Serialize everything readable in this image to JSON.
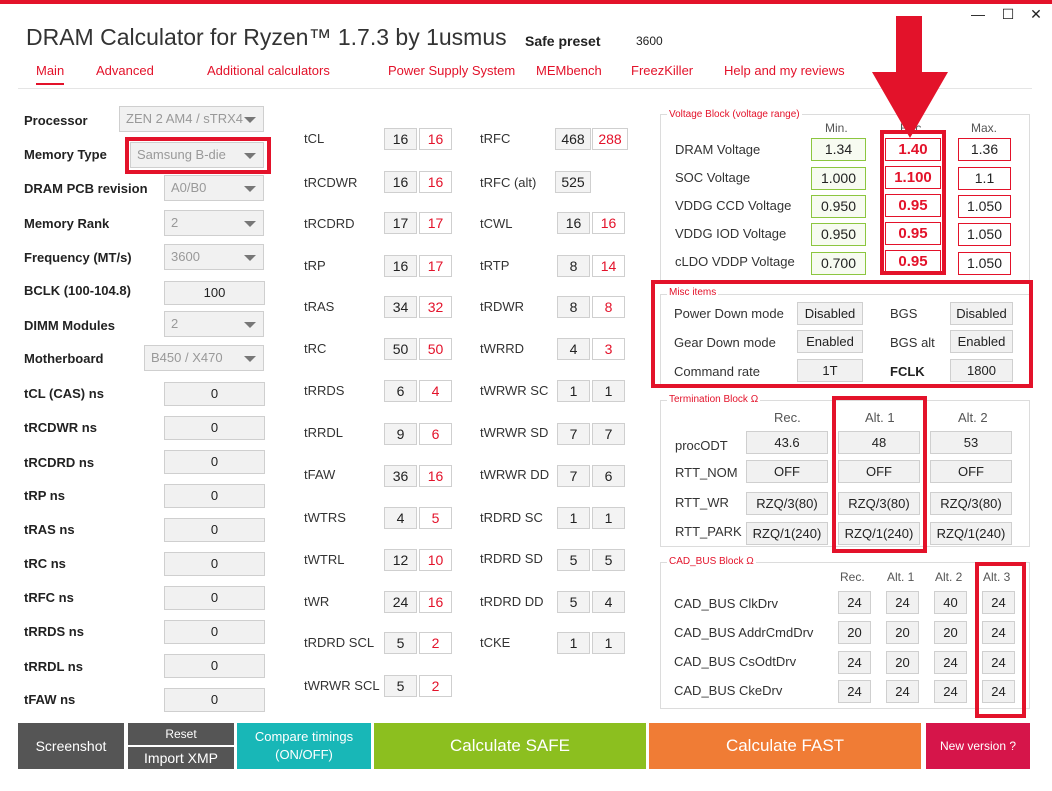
{
  "app": {
    "title": "DRAM Calculator for Ryzen™ 1.7.3 by 1usmus",
    "preset_label": "Safe preset",
    "preset_value": "3600",
    "window_controls": [
      "—",
      "☐",
      "✕"
    ]
  },
  "tabs": [
    "Main",
    "Advanced",
    "Additional calculators",
    "Power Supply System",
    "MEMbench",
    "FreezKiller",
    "Help and my reviews"
  ],
  "left": {
    "fields": [
      {
        "label": "Processor",
        "value": "ZEN 2 AM4 / sTRX4",
        "type": "select"
      },
      {
        "label": "Memory Type",
        "value": "Samsung B-die",
        "type": "select"
      },
      {
        "label": "DRAM PCB revision",
        "value": "A0/B0",
        "type": "select"
      },
      {
        "label": "Memory Rank",
        "value": "2",
        "type": "select"
      },
      {
        "label": "Frequency (MT/s)",
        "value": "3600",
        "type": "select"
      },
      {
        "label": "BCLK (100-104.8)",
        "value": "100",
        "type": "input"
      },
      {
        "label": "DIMM Modules",
        "value": "2",
        "type": "select"
      },
      {
        "label": "Motherboard",
        "value": "B450 / X470",
        "type": "select"
      }
    ],
    "ns_fields": [
      {
        "label": "tCL (CAS) ns",
        "value": "0"
      },
      {
        "label": "tRCDWR ns",
        "value": "0"
      },
      {
        "label": "tRCDRD ns",
        "value": "0"
      },
      {
        "label": "tRP ns",
        "value": "0"
      },
      {
        "label": "tRAS ns",
        "value": "0"
      },
      {
        "label": "tRC ns",
        "value": "0"
      },
      {
        "label": "tRFC ns",
        "value": "0"
      },
      {
        "label": "tRRDS ns",
        "value": "0"
      },
      {
        "label": "tRRDL ns",
        "value": "0"
      },
      {
        "label": "tFAW ns",
        "value": "0"
      }
    ]
  },
  "timings_col1": [
    {
      "label": "tCL",
      "v1": "16",
      "v2": "16"
    },
    {
      "label": "tRCDWR",
      "v1": "16",
      "v2": "16"
    },
    {
      "label": "tRCDRD",
      "v1": "17",
      "v2": "17"
    },
    {
      "label": "tRP",
      "v1": "16",
      "v2": "17"
    },
    {
      "label": "tRAS",
      "v1": "34",
      "v2": "32"
    },
    {
      "label": "tRC",
      "v1": "50",
      "v2": "50"
    },
    {
      "label": "tRRDS",
      "v1": "6",
      "v2": "4"
    },
    {
      "label": "tRRDL",
      "v1": "9",
      "v2": "6"
    },
    {
      "label": "tFAW",
      "v1": "36",
      "v2": "16"
    },
    {
      "label": "tWTRS",
      "v1": "4",
      "v2": "5"
    },
    {
      "label": "tWTRL",
      "v1": "12",
      "v2": "10"
    },
    {
      "label": "tWR",
      "v1": "24",
      "v2": "16"
    },
    {
      "label": "tRDRD SCL",
      "v1": "5",
      "v2": "2"
    },
    {
      "label": "tWRWR SCL",
      "v1": "5",
      "v2": "2"
    }
  ],
  "timings_col2": [
    {
      "label": "tRFC",
      "v1": "468",
      "v2": "288"
    },
    {
      "label": "tRFC (alt)",
      "v1": "525",
      "v2": ""
    },
    {
      "label": "tCWL",
      "v1": "16",
      "v2": "16"
    },
    {
      "label": "tRTP",
      "v1": "8",
      "v2": "14"
    },
    {
      "label": "tRDWR",
      "v1": "8",
      "v2": "8"
    },
    {
      "label": "tWRRD",
      "v1": "4",
      "v2": "3"
    },
    {
      "label": "tWRWR SC",
      "v1": "1",
      "v2": "1"
    },
    {
      "label": "tWRWR SD",
      "v1": "7",
      "v2": "7"
    },
    {
      "label": "tWRWR DD",
      "v1": "7",
      "v2": "6"
    },
    {
      "label": "tRDRD SC",
      "v1": "1",
      "v2": "1"
    },
    {
      "label": "tRDRD SD",
      "v1": "5",
      "v2": "5"
    },
    {
      "label": "tRDRD DD",
      "v1": "5",
      "v2": "4"
    },
    {
      "label": "tCKE",
      "v1": "1",
      "v2": "1"
    }
  ],
  "voltage": {
    "title": "Voltage Block (voltage range)",
    "headers": [
      "Min.",
      "Rec.",
      "Max."
    ],
    "rows": [
      {
        "label": "DRAM Voltage",
        "min": "1.34",
        "rec": "1.40",
        "max": "1.36"
      },
      {
        "label": "SOC Voltage",
        "min": "1.000",
        "rec": "1.100",
        "max": "1.1"
      },
      {
        "label": "VDDG  CCD Voltage",
        "min": "0.950",
        "rec": "0.95",
        "max": "1.050"
      },
      {
        "label": "VDDG  IOD Voltage",
        "min": "0.950",
        "rec": "0.95",
        "max": "1.050"
      },
      {
        "label": "cLDO VDDP Voltage",
        "min": "0.700",
        "rec": "0.95",
        "max": "1.050"
      }
    ]
  },
  "misc": {
    "title": "Misc items",
    "rows": [
      {
        "l1": "Power Down mode",
        "v1": "Disabled",
        "l2": "BGS",
        "v2": "Disabled"
      },
      {
        "l1": "Gear Down mode",
        "v1": "Enabled",
        "l2": "BGS alt",
        "v2": "Enabled"
      },
      {
        "l1": "Command rate",
        "v1": "1T",
        "l2": "FCLK",
        "v2": "1800"
      }
    ]
  },
  "termination": {
    "title": "Termination Block Ω",
    "headers": [
      "Rec.",
      "Alt. 1",
      "Alt. 2"
    ],
    "rows": [
      {
        "label": "procODT",
        "vals": [
          "43.6",
          "48",
          "53"
        ]
      },
      {
        "label": "RTT_NOM",
        "vals": [
          "OFF",
          "OFF",
          "OFF"
        ]
      },
      {
        "label": "RTT_WR",
        "vals": [
          "RZQ/3(80)",
          "RZQ/3(80)",
          "RZQ/3(80)"
        ]
      },
      {
        "label": "RTT_PARK",
        "vals": [
          "RZQ/1(240)",
          "RZQ/1(240)",
          "RZQ/1(240)"
        ]
      }
    ]
  },
  "cadbus": {
    "title": "CAD_BUS Block Ω",
    "headers": [
      "Rec.",
      "Alt. 1",
      "Alt. 2",
      "Alt. 3"
    ],
    "rows": [
      {
        "label": "CAD_BUS ClkDrv",
        "vals": [
          "24",
          "24",
          "40",
          "24"
        ]
      },
      {
        "label": "CAD_BUS AddrCmdDrv",
        "vals": [
          "20",
          "20",
          "20",
          "24"
        ]
      },
      {
        "label": "CAD_BUS CsOdtDrv",
        "vals": [
          "24",
          "20",
          "24",
          "24"
        ]
      },
      {
        "label": "CAD_BUS CkeDrv",
        "vals": [
          "24",
          "24",
          "24",
          "24"
        ]
      }
    ]
  },
  "buttons": {
    "screenshot": "Screenshot",
    "reset": "Reset",
    "import_xmp": "Import XMP",
    "compare_line1": "Compare timings",
    "compare_line2": "(ON/OFF)",
    "calc_safe": "Calculate SAFE",
    "calc_fast": "Calculate FAST",
    "new_version": "New version ?"
  },
  "colors": {
    "accent_red": "#e3122a",
    "gray_btn": "#555555",
    "teal_btn": "#18b7b7",
    "green_btn": "#8cbf1f",
    "orange_btn": "#f07c35",
    "crimson_btn": "#d6154a"
  }
}
